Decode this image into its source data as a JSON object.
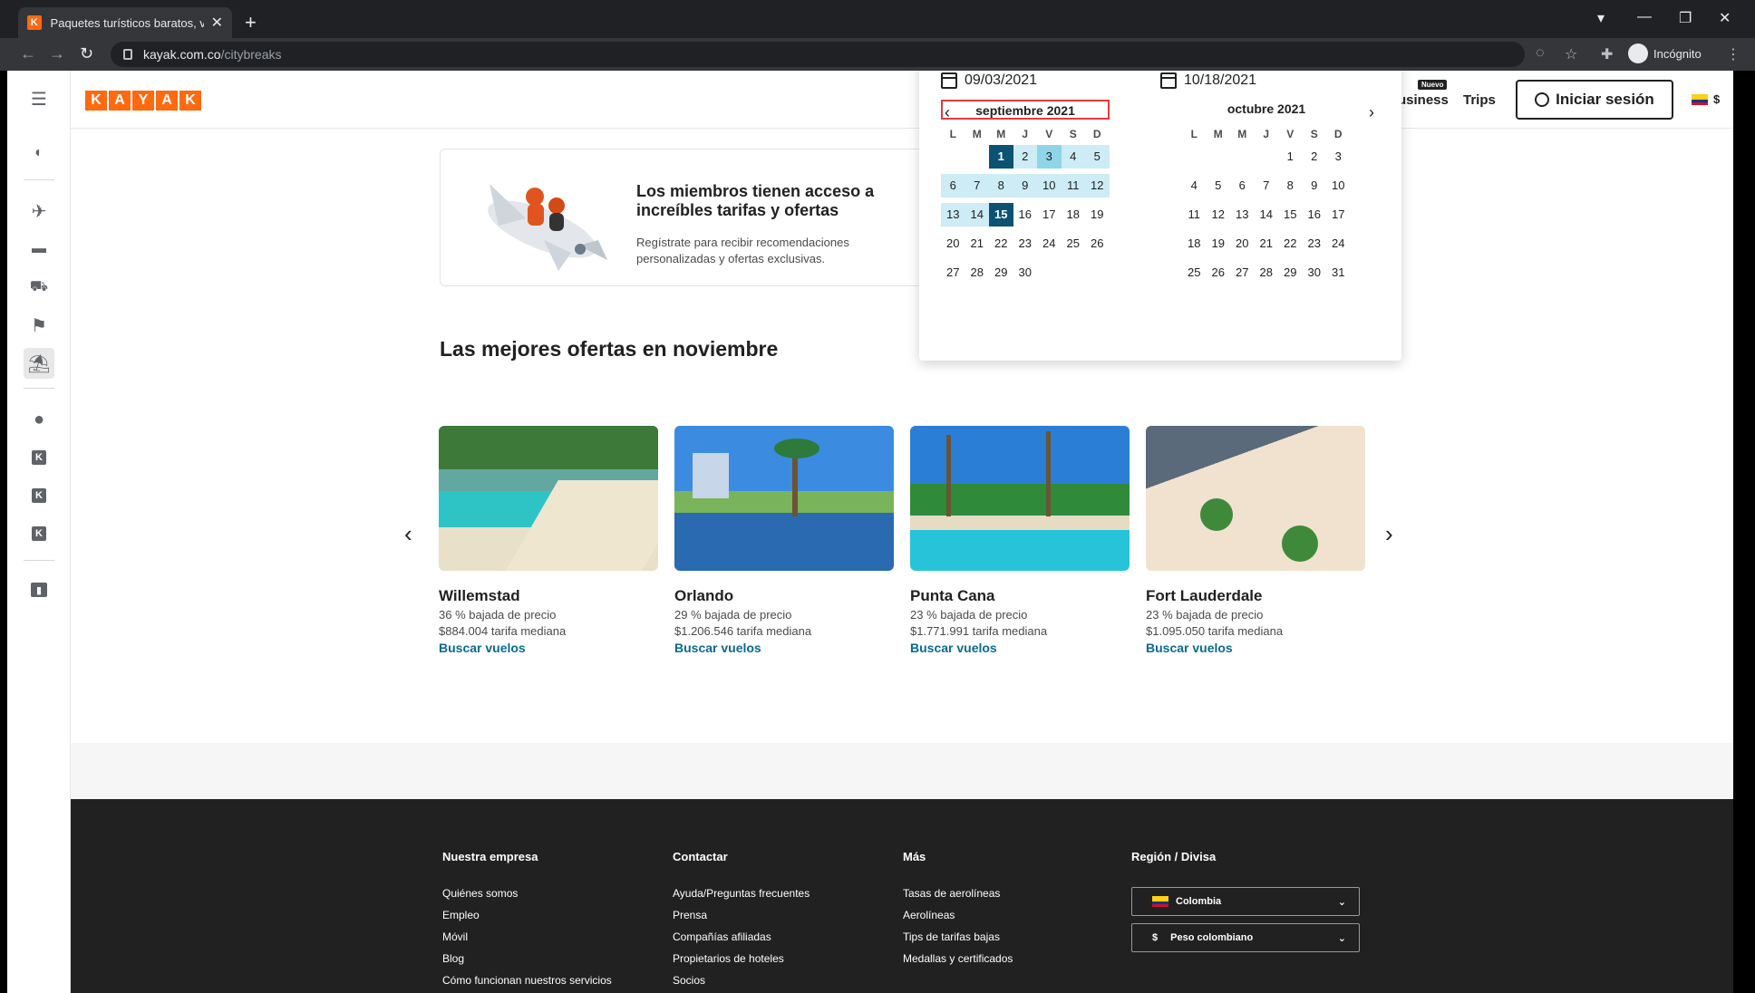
{
  "browser": {
    "tab_title": "Paquetes turísticos baratos, vuelo",
    "tab_close": "✕",
    "new_tab": "+",
    "url_host": "kayak.com.co",
    "url_path": "/citybreaks",
    "profile": "Incógnito"
  },
  "header": {
    "logo": [
      "K",
      "A",
      "Y",
      "A",
      "K"
    ],
    "new_badge": "Nuevo",
    "business": "usiness",
    "trips": "Trips",
    "signin": "Iniciar sesión",
    "currency": "$"
  },
  "member": {
    "title": "Los miembros tienen acceso a increíbles tarifas y ofertas",
    "text": "Regístrate para recibir recomendaciones personalizadas y ofertas exclusivas."
  },
  "calendar": {
    "start_date": "09/03/2021",
    "end_date": "10/18/2021",
    "dow": [
      "L",
      "M",
      "M",
      "J",
      "V",
      "S",
      "D"
    ],
    "months": [
      {
        "title": "septiembre 2021",
        "weeks": [
          [
            {
              "v": ""
            },
            {
              "v": ""
            },
            {
              "v": "1",
              "s": "d"
            },
            {
              "v": "2",
              "s": "r"
            },
            {
              "v": "3",
              "s": "x"
            },
            {
              "v": "4",
              "s": "r"
            },
            {
              "v": "5",
              "s": "r"
            }
          ],
          [
            {
              "v": "6",
              "s": "r"
            },
            {
              "v": "7",
              "s": "r"
            },
            {
              "v": "8",
              "s": "r"
            },
            {
              "v": "9",
              "s": "r"
            },
            {
              "v": "10",
              "s": "r"
            },
            {
              "v": "11",
              "s": "r"
            },
            {
              "v": "12",
              "s": "r"
            }
          ],
          [
            {
              "v": "13",
              "s": "r"
            },
            {
              "v": "14",
              "s": "r"
            },
            {
              "v": "15",
              "s": "d"
            },
            {
              "v": "16"
            },
            {
              "v": "17"
            },
            {
              "v": "18"
            },
            {
              "v": "19"
            }
          ],
          [
            {
              "v": "20"
            },
            {
              "v": "21"
            },
            {
              "v": "22"
            },
            {
              "v": "23"
            },
            {
              "v": "24"
            },
            {
              "v": "25"
            },
            {
              "v": "26"
            }
          ],
          [
            {
              "v": "27"
            },
            {
              "v": "28"
            },
            {
              "v": "29"
            },
            {
              "v": "30"
            },
            {
              "v": ""
            },
            {
              "v": ""
            },
            {
              "v": ""
            }
          ]
        ]
      },
      {
        "title": "octubre 2021",
        "weeks": [
          [
            {
              "v": ""
            },
            {
              "v": ""
            },
            {
              "v": ""
            },
            {
              "v": ""
            },
            {
              "v": "1"
            },
            {
              "v": "2"
            },
            {
              "v": "3"
            }
          ],
          [
            {
              "v": "4"
            },
            {
              "v": "5"
            },
            {
              "v": "6"
            },
            {
              "v": "7"
            },
            {
              "v": "8"
            },
            {
              "v": "9"
            },
            {
              "v": "10"
            }
          ],
          [
            {
              "v": "11"
            },
            {
              "v": "12"
            },
            {
              "v": "13"
            },
            {
              "v": "14"
            },
            {
              "v": "15"
            },
            {
              "v": "16"
            },
            {
              "v": "17"
            }
          ],
          [
            {
              "v": "18"
            },
            {
              "v": "19"
            },
            {
              "v": "20"
            },
            {
              "v": "21"
            },
            {
              "v": "22"
            },
            {
              "v": "23"
            },
            {
              "v": "24"
            }
          ],
          [
            {
              "v": "25"
            },
            {
              "v": "26"
            },
            {
              "v": "27"
            },
            {
              "v": "28"
            },
            {
              "v": "29"
            },
            {
              "v": "30"
            },
            {
              "v": "31"
            }
          ]
        ]
      }
    ]
  },
  "deals": {
    "title": "Las mejores ofertas en noviembre",
    "items": [
      {
        "city": "Willemstad",
        "drop": "36 % bajada de precio",
        "price": "$884.004 tarifa mediana",
        "link": "Buscar vuelos",
        "theme": "beach-crowd"
      },
      {
        "city": "Orlando",
        "drop": "29 % bajada de precio",
        "price": "$1.206.546 tarifa mediana",
        "link": "Buscar vuelos",
        "theme": "lake-palms"
      },
      {
        "city": "Punta Cana",
        "drop": "23 % bajada de precio",
        "price": "$1.771.991 tarifa mediana",
        "link": "Buscar vuelos",
        "theme": "pool-palms"
      },
      {
        "city": "Fort Lauderdale",
        "drop": "23 % bajada de precio",
        "price": "$1.095.050 tarifa mediana",
        "link": "Buscar vuelos",
        "theme": "aerial-palms"
      }
    ]
  },
  "footer": {
    "cols": [
      {
        "title": "Nuestra empresa",
        "links": [
          "Quiénes somos",
          "Empleo",
          "Móvil",
          "Blog",
          "Cómo funcionan nuestros servicios"
        ]
      },
      {
        "title": "Contactar",
        "links": [
          "Ayuda/Preguntas frecuentes",
          "Prensa",
          "Compañías afiliadas",
          "Propietarios de hoteles",
          "Socios"
        ]
      },
      {
        "title": "Más",
        "links": [
          "Tasas de aerolíneas",
          "Aerolíneas",
          "Tips de tarifas bajas",
          "Medallas y certificados"
        ]
      }
    ],
    "region_title": "Región / Divisa",
    "country": "Colombia",
    "currency_symbol": "$",
    "currency_name": "Peso colombiano"
  },
  "colors": {
    "brand": "#ff690f",
    "selected_day": "#0c5272",
    "range": "#cdecf5",
    "link": "#0a6a8c"
  }
}
